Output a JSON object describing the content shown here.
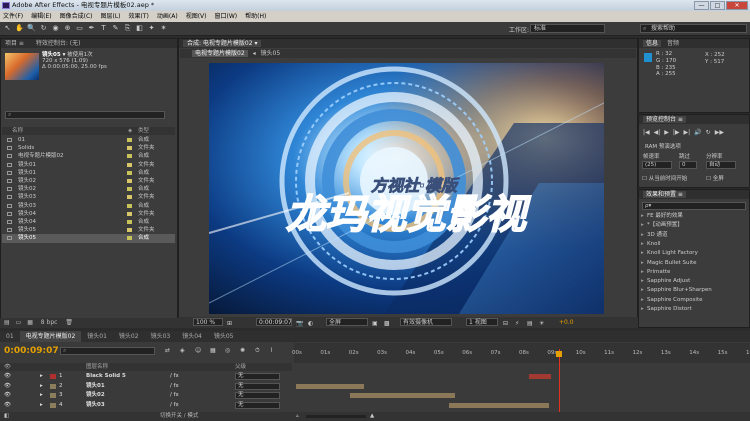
{
  "window": {
    "title": "Adobe After Effects - 电视专题片模板02.aep *",
    "controls": [
      "—",
      "□",
      "✕"
    ]
  },
  "menu": [
    "文件(F)",
    "编辑(E)",
    "图像合成(C)",
    "图层(L)",
    "效果(T)",
    "动画(A)",
    "视图(V)",
    "窗口(W)",
    "帮助(H)"
  ],
  "toolbar": {
    "workspace_label": "工作区:",
    "workspace_value": "标准",
    "help_placeholder": "搜索帮助"
  },
  "project": {
    "tab_project": "项目 ≡",
    "tab_effect_controls": "特效控制台: (无)",
    "selected_name": "镜头05 ▾",
    "selected_usage": "被使用1次",
    "selected_dims": "720 x 576 (1.09)",
    "selected_duration": "Δ 0:00:05:00, 25.00 fps",
    "col_name": "名称",
    "col_type": "类型",
    "items": [
      {
        "name": "01",
        "type": "合成",
        "color": "#c7c35a",
        "selected": false
      },
      {
        "name": "Solids",
        "type": "文件夹",
        "color": "#d7c66a",
        "selected": false
      },
      {
        "name": "电视专题片模版02",
        "type": "合成",
        "color": "#c7c35a",
        "selected": false
      },
      {
        "name": "镜头01",
        "type": "文件夹",
        "color": "#d7c66a",
        "selected": false
      },
      {
        "name": "镜头01",
        "type": "合成",
        "color": "#c7c35a",
        "selected": false
      },
      {
        "name": "镜头02",
        "type": "文件夹",
        "color": "#d7c66a",
        "selected": false
      },
      {
        "name": "镜头02",
        "type": "合成",
        "color": "#c7c35a",
        "selected": false
      },
      {
        "name": "镜头03",
        "type": "文件夹",
        "color": "#d7c66a",
        "selected": false
      },
      {
        "name": "镜头03",
        "type": "合成",
        "color": "#c7c35a",
        "selected": false
      },
      {
        "name": "镜头04",
        "type": "文件夹",
        "color": "#d7c66a",
        "selected": false
      },
      {
        "name": "镜头04",
        "type": "合成",
        "color": "#c7c35a",
        "selected": false
      },
      {
        "name": "镜头05",
        "type": "文件夹",
        "color": "#d7c66a",
        "selected": false
      },
      {
        "name": "镜头05",
        "type": "合成",
        "color": "#c7c35a",
        "selected": true
      }
    ],
    "footer_bpc": "8 bpc"
  },
  "composition": {
    "tab_label": "合成: 电视专题片模版02 ▾",
    "sub_tabs": [
      "电视专题片模版02",
      "镜头05"
    ],
    "zoom": "100 %",
    "timecode": "0:00:09:07",
    "resolution": "全屏",
    "camera": "有效摄像机",
    "views": "1 视图",
    "offset": "+0.0",
    "viewer_title": "龙玛视觉影视",
    "viewer_subtitle": "方视社·模版"
  },
  "info": {
    "tab_info": "信息",
    "tab_audio": "音频",
    "r": "R : 32",
    "g": "G : 170",
    "b": "B : 235",
    "a": "A : 255",
    "x": "X : 252",
    "y": "Y : 517",
    "swatch_color": "#2090d0"
  },
  "preview": {
    "tab": "预览控制台 ≡",
    "ram_label": "RAM 预演选项",
    "fps_label": "帧速率",
    "skip_label": "跳过",
    "res_label": "分辨率",
    "fps_value": "(25)",
    "skip_value": "0",
    "res_value": "自动",
    "from_current": "从当前时间开始",
    "fullscreen": "全屏"
  },
  "effects": {
    "tab": "效果和预置 ≡",
    "search_placeholder": "ρ▾",
    "items": [
      "FE 最好的效果",
      "*【动画预置】",
      "3D 通道",
      "Knoll",
      "Knoll Light Factory",
      "Magic Bullet Suite",
      "Primatte",
      "Sapphire Adjust",
      "Sapphire Blur+Sharpen",
      "Sapphire Composite",
      "Sapphire Distort"
    ]
  },
  "timeline": {
    "tabs": [
      "01",
      "电视专题片模版02",
      "镜头01",
      "镜头02",
      "镜头03",
      "镜头04",
      "镜头05"
    ],
    "active_tab": 1,
    "timecode": "0:00:09:07",
    "col_layer": "图层名称",
    "col_parent": "父级",
    "layers": [
      {
        "num": "1",
        "name": "Black Solid 5",
        "color": "#b03030",
        "parent": "无"
      },
      {
        "num": "2",
        "name": "镜头01",
        "color": "#8c7d5c",
        "parent": "无"
      },
      {
        "num": "3",
        "name": "镜头02",
        "color": "#8c7d5c",
        "parent": "无"
      },
      {
        "num": "4",
        "name": "镜头03",
        "color": "#8c7d5c",
        "parent": "无"
      }
    ],
    "ruler": [
      "00s",
      "01s",
      "02s",
      "03s",
      "04s",
      "05s",
      "06s",
      "07s",
      "08s",
      "09s",
      "10s",
      "11s",
      "12s",
      "13s",
      "14s",
      "15s",
      "16s"
    ],
    "footer_label": "切换开关 / 模式",
    "playhead_seconds": 9.28
  }
}
